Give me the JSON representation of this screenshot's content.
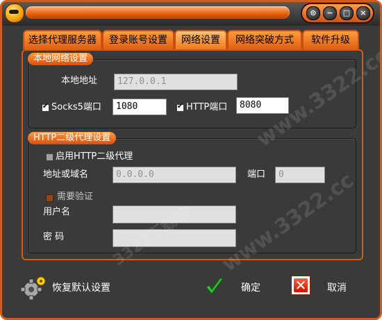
{
  "window": {
    "controls": [
      "⊙",
      "−",
      "□",
      "×"
    ]
  },
  "tabs": [
    "选择代理服务器",
    "登录账号设置",
    "网络设置",
    "网络突破方式",
    "软件升级"
  ],
  "local": {
    "title": "本地网络设置",
    "address_label": "本地地址",
    "address_value": "127.0.0.1",
    "socks_label": "Socks5端口",
    "socks_value": "1080",
    "http_label": "HTTP端口",
    "http_value": "8080"
  },
  "proxy": {
    "title": "HTTP二级代理设置",
    "enable_label": "启用HTTP二级代理",
    "host_label": "地址或域名",
    "host_value": "0.0.0.0",
    "port_label": "端口",
    "port_value": "0",
    "auth_label": "需要验证",
    "user_label": "用户名",
    "user_value": "",
    "pass_label": "密  码",
    "pass_value": ""
  },
  "footer": {
    "restore_label": "恢复默认设置",
    "ok_label": "确定",
    "cancel_label": "取消"
  },
  "watermark": [
    "www.3322.cc",
    "3322下载站"
  ]
}
